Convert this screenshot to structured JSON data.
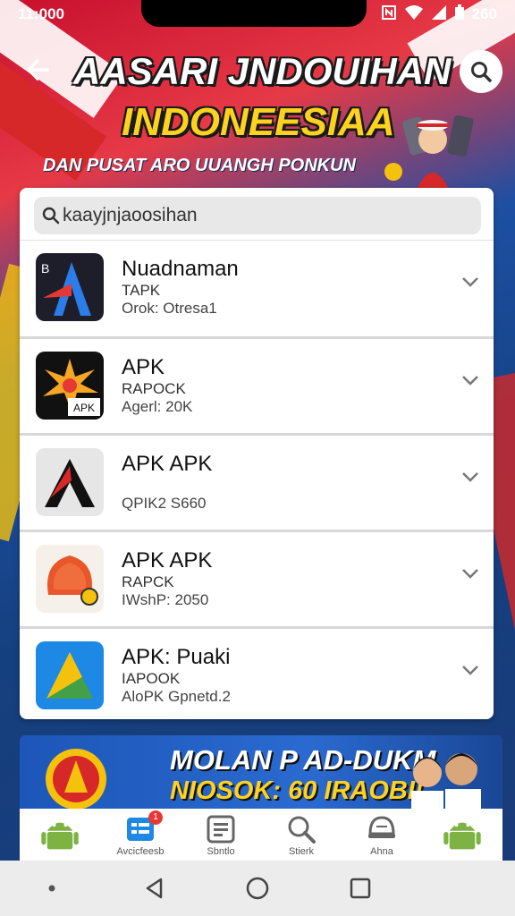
{
  "status_bar": {
    "time": "11:000",
    "battery": "260"
  },
  "header": {
    "headline_line1": "AASARI JNDOUIHAN",
    "headline_line2": "INDONEESIAA",
    "subheadline": "DAN PUSAT ARO UUANGH PONKUN"
  },
  "search": {
    "placeholder": "kaayjnjaoosihan",
    "value": "kaayjnjaoosihan"
  },
  "apps": [
    {
      "name": "Nuadnaman",
      "subtitle": "TAPK",
      "meta": "Orok:  Otresa1"
    },
    {
      "name": "APK",
      "subtitle": "RAPOCK",
      "meta": "Agerl:   20K"
    },
    {
      "name": "APK APK",
      "subtitle": "",
      "meta": "QPIK2    S660"
    },
    {
      "name": "APK APK",
      "subtitle": "RAPCK",
      "meta": "IWshP:   2050"
    },
    {
      "name": "APK: Puaki",
      "subtitle": "IAPOOK",
      "meta": "AloPK   Gpnetd.2"
    }
  ],
  "promo": {
    "line1": "MOLAN P AD-DUKM",
    "line2": "NIOSOK: 60 IRAOBI!"
  },
  "tabs": [
    {
      "label": "",
      "icon": "android-icon"
    },
    {
      "label": "Avcicfeesb",
      "icon": "list-icon",
      "badge": "1"
    },
    {
      "label": "Sbntlo",
      "icon": "document-icon"
    },
    {
      "label": "Stierk",
      "icon": "search-icon"
    },
    {
      "label": "Ahna",
      "icon": "helmet-icon"
    },
    {
      "label": "",
      "icon": "android-icon"
    }
  ],
  "colors": {
    "accent_blue": "#1d4fa3",
    "flag_red": "#c8102e",
    "headline_yellow": "#ffd21f"
  }
}
